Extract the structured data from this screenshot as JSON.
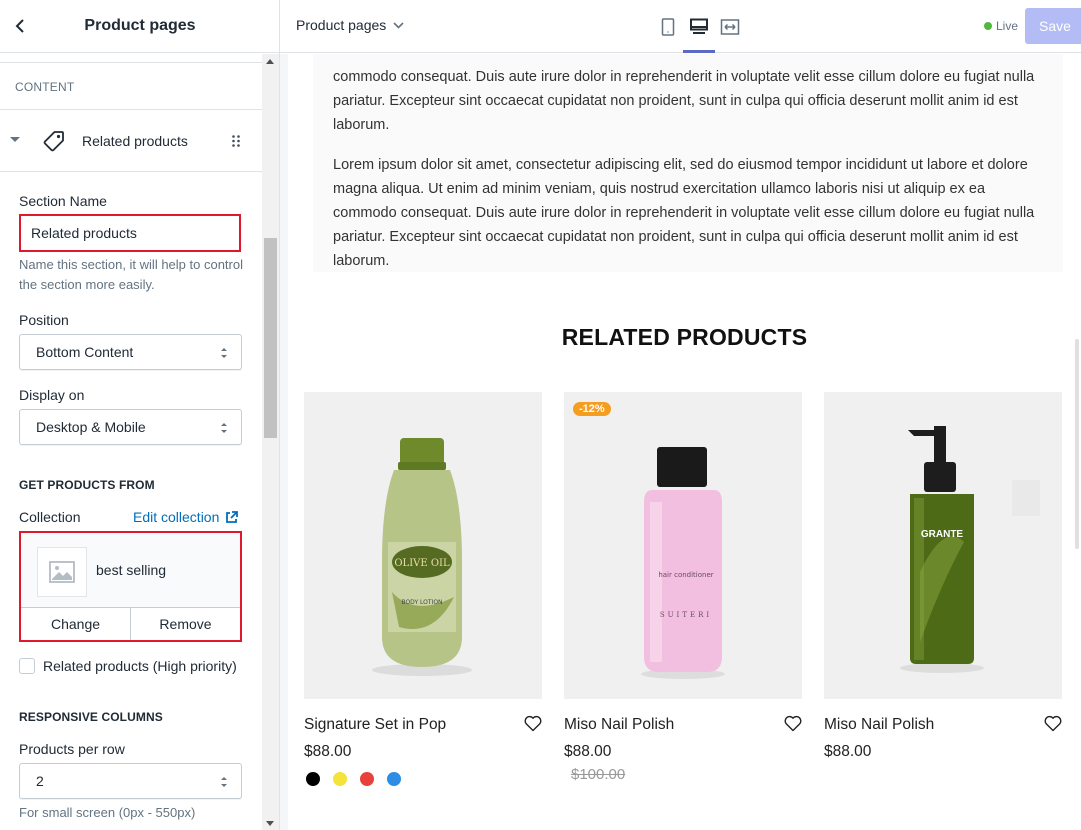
{
  "left_panel": {
    "title": "Product pages",
    "content_label": "CONTENT",
    "section_label": "Related products",
    "section_name": {
      "label": "Section Name",
      "value": "Related products",
      "help": "Name this section, it will help to control the section more easily."
    },
    "position": {
      "label": "Position",
      "value": "Bottom Content"
    },
    "display_on": {
      "label": "Display on",
      "value": "Desktop & Mobile"
    },
    "get_products_heading": "GET PRODUCTS FROM",
    "collection": {
      "label": "Collection",
      "edit_link": "Edit collection",
      "name": "best selling",
      "change_label": "Change",
      "remove_label": "Remove"
    },
    "priority_label": "Related products (High priority)",
    "priority_checked": false,
    "responsive_heading": "RESPONSIVE COLUMNS",
    "products_per_row": {
      "label": "Products per row",
      "value": "2",
      "help": "For small screen (0px - 550px)"
    }
  },
  "topbar": {
    "page_selector": "Product pages",
    "devices": [
      "mobile-icon",
      "desktop-icon",
      "fullwidth-icon"
    ],
    "active_device": "desktop-icon",
    "live_label": "Live",
    "save_label": "Save"
  },
  "preview": {
    "paragraph_1": "commodo consequat. Duis aute irure dolor in reprehenderit in voluptate velit esse cillum dolore eu fugiat nulla pariatur. Excepteur sint occaecat cupidatat non proident, sunt in culpa qui officia deserunt mollit anim id est laborum.",
    "paragraph_2": "Lorem ipsum dolor sit amet, consectetur adipiscing elit, sed do eiusmod tempor incididunt ut labore et dolore magna aliqua. Ut enim ad minim veniam, quis nostrud exercitation ullamco laboris nisi ut aliquip ex ea commodo consequat. Duis aute irure dolor in reprehenderit in voluptate velit esse cillum dolore eu fugiat nulla pariatur. Excepteur sint occaecat cupidatat non proident, sunt in culpa qui officia deserunt mollit anim id est laborum.",
    "related_heading": "RELATED PRODUCTS",
    "products": [
      {
        "name": "Signature Set in Pop",
        "price": "$88.00",
        "swatches": [
          "#000000",
          "#f5e23a",
          "#e8403a",
          "#2b8de3"
        ],
        "bottle_label_1": "OLIVE OIL",
        "bottle_label_2": "BODY LOTION"
      },
      {
        "name": "Miso Nail Polish",
        "price": "$88.00",
        "old_price": "$100.00",
        "badge": "-12%",
        "bottle_label_1": "hair conditioner",
        "bottle_label_2": "SUITERI"
      },
      {
        "name": "Miso Nail Polish",
        "price": "$88.00",
        "bottle_label_1": "GRANTE"
      }
    ]
  },
  "colors": {
    "accent": "#5c6ac4",
    "highlight_border": "#e0182d",
    "link": "#006fbb",
    "live": "#50b83c",
    "sale_badge": "#f59d1f",
    "save_disabled": "#b3bcf5"
  }
}
